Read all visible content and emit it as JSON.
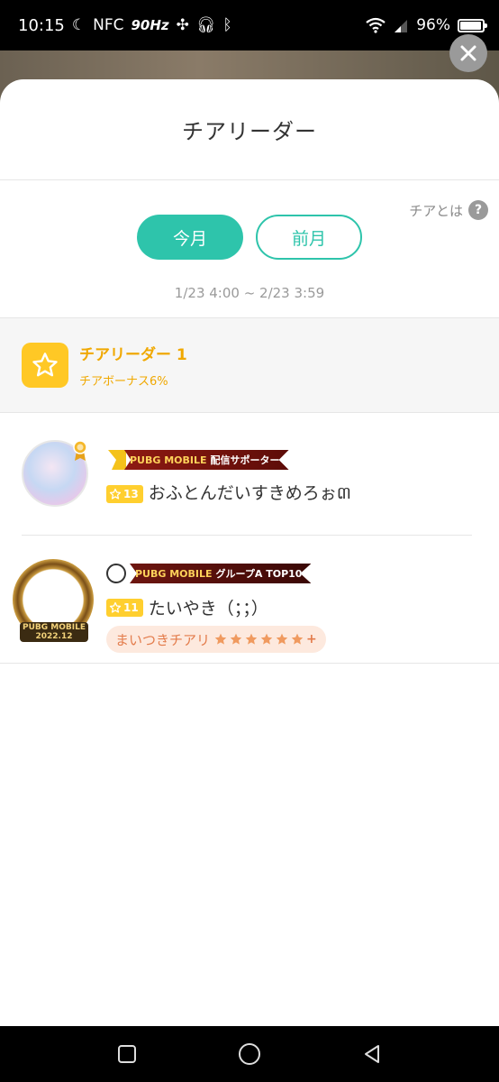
{
  "status_bar": {
    "time": "10:15",
    "nfc": "NFC",
    "refresh": "90Hz",
    "battery": "96%",
    "battery_level": 0.96
  },
  "sheet": {
    "title": "チアリーダー",
    "help_label": "チアとは",
    "help_icon_label": "?",
    "tabs": [
      {
        "label": "今月",
        "active": true
      },
      {
        "label": "前月",
        "active": false
      }
    ],
    "period": "1/23 4:00 ~ 2/23 3:59"
  },
  "rank": {
    "title": "チアリーダー 1",
    "bonus": "チアボーナス6%"
  },
  "users": [
    {
      "badge_highlight": "PUBG MOBILE",
      "badge_text": "配信サポーター",
      "level": "13",
      "name": "おふとんだいすきめろぉ៣"
    },
    {
      "badge_highlight": "PUBG MOBILE",
      "badge_text": "グループA TOP10",
      "level": "11",
      "name": "たいやき（；；）",
      "frame_label_1": "PUBG MOBILE",
      "frame_label_2": "2022.12",
      "cheer_label": "まいつきチアリ",
      "cheer_stars": 6,
      "cheer_plus": "+"
    }
  ],
  "colors": {
    "accent": "#2ec4ab",
    "gold": "#f0a800",
    "star": "#ffc825"
  }
}
